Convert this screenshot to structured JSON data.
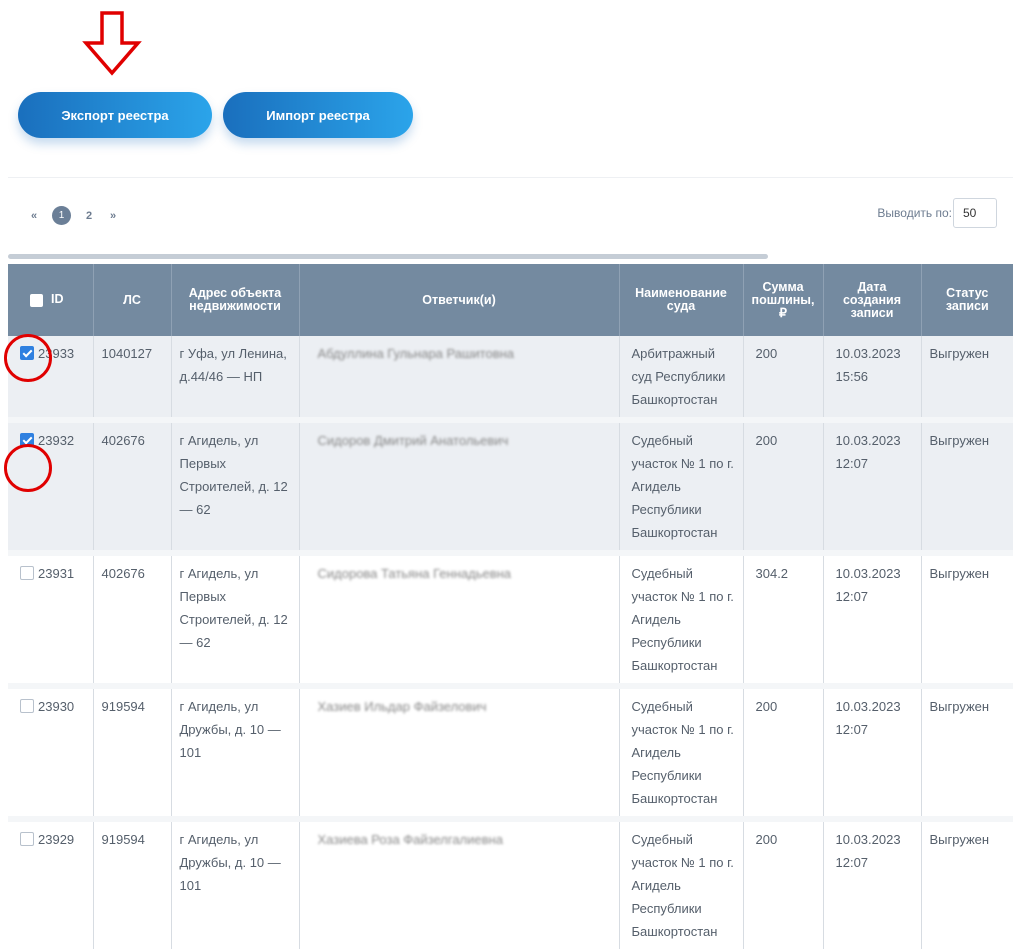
{
  "toolbar": {
    "export_label": "Экспорт реестра",
    "import_label": "Импорт реестра"
  },
  "pagination": {
    "prev": "«",
    "pages": [
      "1",
      "2"
    ],
    "current": "1",
    "next": "»",
    "per_page_label": "Выводить по:",
    "per_page_value": "50"
  },
  "table": {
    "headers": {
      "id": "ID",
      "ls": "ЛС",
      "address": "Адрес объекта недвижимости",
      "defendant": "Ответчик(и)",
      "court": "Наименование суда",
      "fee": "Сумма пошлины, ₽",
      "created": "Дата создания записи",
      "status": "Статус записи"
    },
    "rows": [
      {
        "id": "23933",
        "ls": "1040127",
        "address": "г Уфа, ул Ленина, д.44/46 — НП",
        "defendant": "Абдуллина Гульнара Рашитовна",
        "court": "Арбитражный суд Республики Башкортостан",
        "fee": "200",
        "created": "10.03.2023 15:56",
        "status": "Выгружен",
        "checked": true
      },
      {
        "id": "23932",
        "ls": "402676",
        "address": "г Агидель, ул Первых Строителей, д. 12 — 62",
        "defendant": "Сидоров Дмитрий Анатольевич",
        "court": "Судебный участок № 1 по г. Агидель Республики Башкортостан",
        "fee": "200",
        "created": "10.03.2023 12:07",
        "status": "Выгружен",
        "checked": true
      },
      {
        "id": "23931",
        "ls": "402676",
        "address": "г Агидель, ул Первых Строителей, д. 12 — 62",
        "defendant": "Сидорова Татьяна Геннадьевна",
        "court": "Судебный участок № 1 по г. Агидель Республики Башкортостан",
        "fee": "304.2",
        "created": "10.03.2023 12:07",
        "status": "Выгружен",
        "checked": false
      },
      {
        "id": "23930",
        "ls": "919594",
        "address": "г Агидель, ул Дружбы, д. 10 — 101",
        "defendant": "Хазиев Ильдар Файзелович",
        "court": "Судебный участок № 1 по г. Агидель Республики Башкортостан",
        "fee": "200",
        "created": "10.03.2023 12:07",
        "status": "Выгружен",
        "checked": false
      },
      {
        "id": "23929",
        "ls": "919594",
        "address": "г Агидель, ул Дружбы, д. 10 — 101",
        "defendant": "Хазиева Роза Файзелгалиевна",
        "court": "Судебный участок № 1 по г. Агидель Республики Башкортостан",
        "fee": "200",
        "created": "10.03.2023 12:07",
        "status": "Выгружен",
        "checked": false
      }
    ]
  },
  "colors": {
    "annotation_red": "#e00000",
    "header_bg": "#748aa0",
    "button_gradient_start": "#1a6fbd",
    "button_gradient_end": "#2ba4ea",
    "checkbox_checked": "#2f80e0"
  }
}
